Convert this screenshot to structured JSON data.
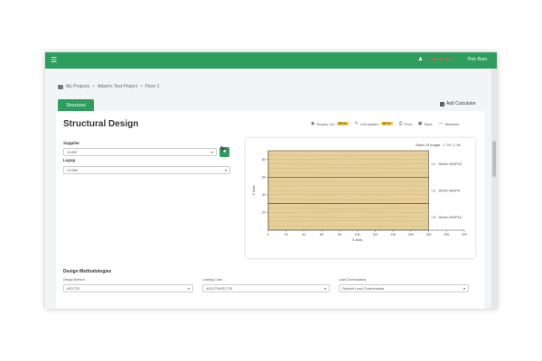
{
  "topbar": {
    "menu_icon": "hamburger-icon",
    "bell_icon": "bell-icon",
    "notice": "● ●●●●● ●●●",
    "user": "Petr Burn"
  },
  "breadcrumb": {
    "items": [
      "My Projects",
      "Adam's Test Project",
      "Floor 1"
    ]
  },
  "tabs": {
    "structural": "Structural",
    "add_calculator": "Add Calculator"
  },
  "panel": {
    "title": "Structural Design",
    "toolbar": {
      "region": "Region: AU",
      "region_badge": "BETA",
      "unit_system": "Unit system",
      "unit_badge": "BETA",
      "print": "Print",
      "save": "Save",
      "minimize": "Minimize"
    },
    "supplier_label": "Supplier",
    "supplier_value": "XLAM",
    "layup_label": "Layup",
    "layup_value": "XC890",
    "methodologies_title": "Design Methodologies",
    "design_method_label": "Design Method",
    "design_method_value": "AS1720",
    "loading_code_label": "Loading Code",
    "loading_code_value": "AS1170/AS1720",
    "load_combinations_label": "Load Combinations",
    "load_combinations_value": "Default Load Combination"
  },
  "chart_data": {
    "type": "other",
    "title": "Ratio Of Image : 1.79 / 1.18",
    "xlabel": "X Axis",
    "ylabel": "Y Axis",
    "xlim": [
      0,
      220
    ],
    "ylim": [
      0,
      90
    ],
    "x_ticks": [
      "0",
      "20",
      "40",
      "60",
      "80",
      "100",
      "120",
      "140",
      "160",
      "180",
      "200",
      "220"
    ],
    "y_ticks": [
      "20",
      "40",
      "60",
      "80"
    ],
    "layers": [
      {
        "label": "L1 : 30mm MGP10",
        "y_from": 60,
        "y_to": 90
      },
      {
        "label": "L2 : 30mm MGP9",
        "y_from": 30,
        "y_to": 60
      },
      {
        "label": "L3 : 30mm MGP10",
        "y_from": 0,
        "y_to": 30
      }
    ],
    "panel_width": 180,
    "colors": {
      "wood": "#e6cf9b",
      "grain": "#c9ad74",
      "line": "#5a4a30"
    }
  }
}
